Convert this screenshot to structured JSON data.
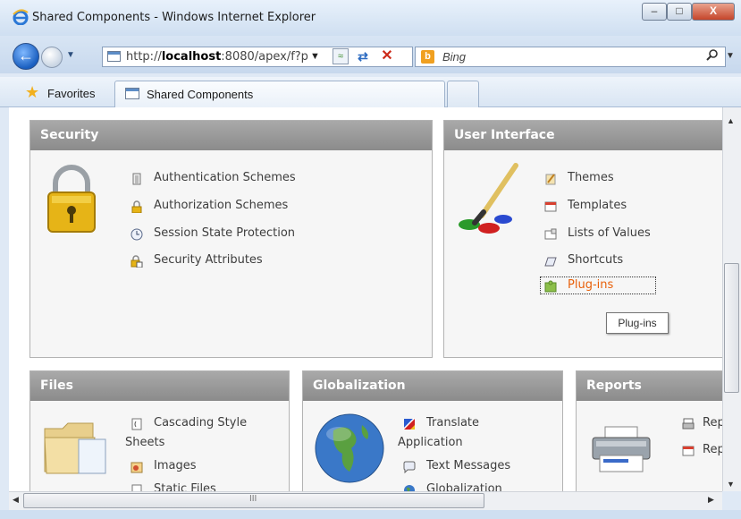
{
  "window": {
    "title": "Shared Components - Windows Internet Explorer"
  },
  "nav": {
    "url_prefix": "http://",
    "url_host": "localhost",
    "url_rest": ":8080/apex/f?p",
    "search_placeholder": "Bing"
  },
  "favorites": {
    "label": "Favorites"
  },
  "tab": {
    "label": "Shared Components"
  },
  "panels": {
    "security": {
      "title": "Security",
      "items": [
        "Authentication Schemes",
        "Authorization Schemes",
        "Session State Protection",
        "Security Attributes"
      ]
    },
    "user_interface": {
      "title": "User Interface",
      "items": [
        "Themes",
        "Templates",
        "Lists of Values",
        "Shortcuts",
        "Plug-ins"
      ]
    },
    "files": {
      "title": "Files",
      "items": [
        "Cascading Style",
        "Sheets",
        "Images",
        "Static Files"
      ]
    },
    "globalization": {
      "title": "Globalization",
      "items": [
        "Translate",
        "Application",
        "Text Messages",
        "Globalization"
      ]
    },
    "reports": {
      "title": "Reports",
      "items": [
        "Rep",
        "Rep"
      ]
    }
  },
  "tooltip": "Plug-ins",
  "colors": {
    "link_active": "#e8600a",
    "panel_header": "#999999"
  },
  "scroll_grip": "III"
}
